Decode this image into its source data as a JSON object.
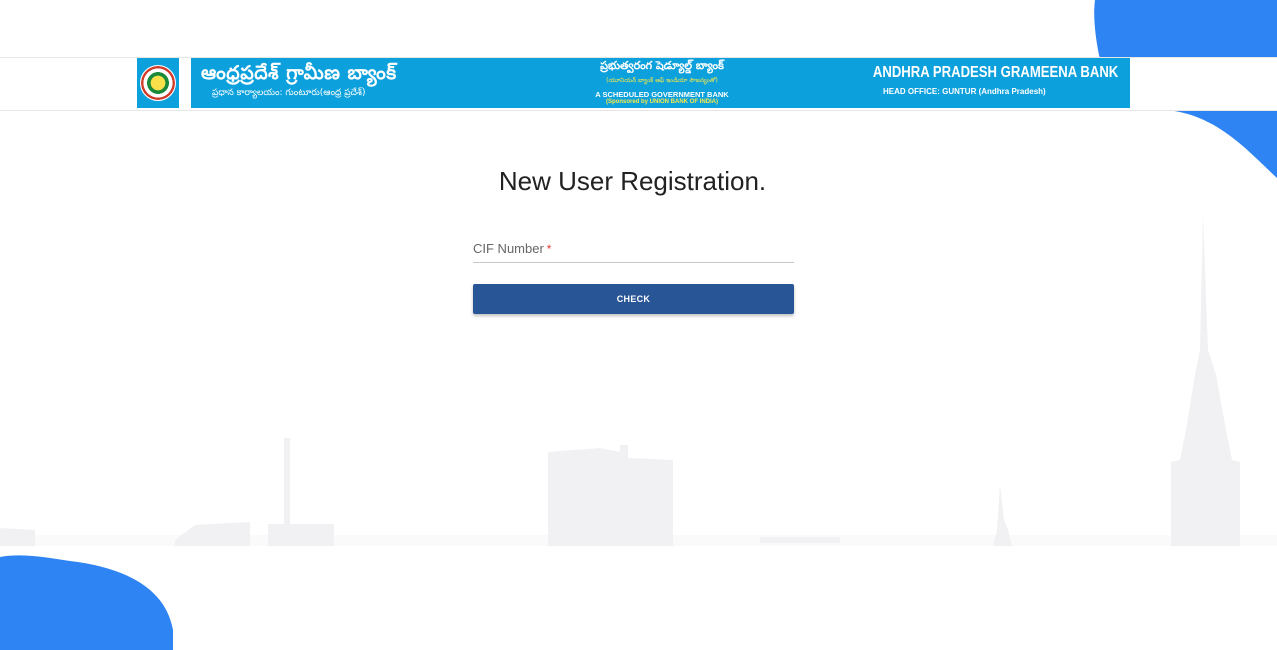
{
  "banner": {
    "telugu_title": "ఆంధ్రప్రదేశ్ గ్రామీణ బ్యాంక్",
    "telugu_subtitle": "ప్రధాన కార్యాలయం: గుంటూరు(ఆంధ్ర ప్రదేశ్)",
    "center_telugu": "ప్రభుత్వరంగ షెడ్యూల్డ్ బ్యాంక్",
    "center_telugu_sub": "(యూనియన్ బ్యాంక్ ఆఫ్ ఇండియా సౌజన్యంతో)",
    "center_english": "A SCHEDULED GOVERNMENT BANK",
    "center_english_sub": "(Sponsored by UNION BANK OF INDIA)",
    "english_title": "ANDHRA PRADESH GRAMEENA BANK",
    "english_subtitle": "HEAD OFFICE: GUNTUR (Andhra Pradesh)"
  },
  "form": {
    "title": "New User Registration.",
    "cif_label": "CIF Number",
    "required_marker": "*",
    "cif_value": "",
    "check_label": "CHECK"
  },
  "colors": {
    "accent_blob": "#2f84f3",
    "banner_bg": "#0ca0dc",
    "button_bg": "#275596",
    "required": "#e53935"
  }
}
